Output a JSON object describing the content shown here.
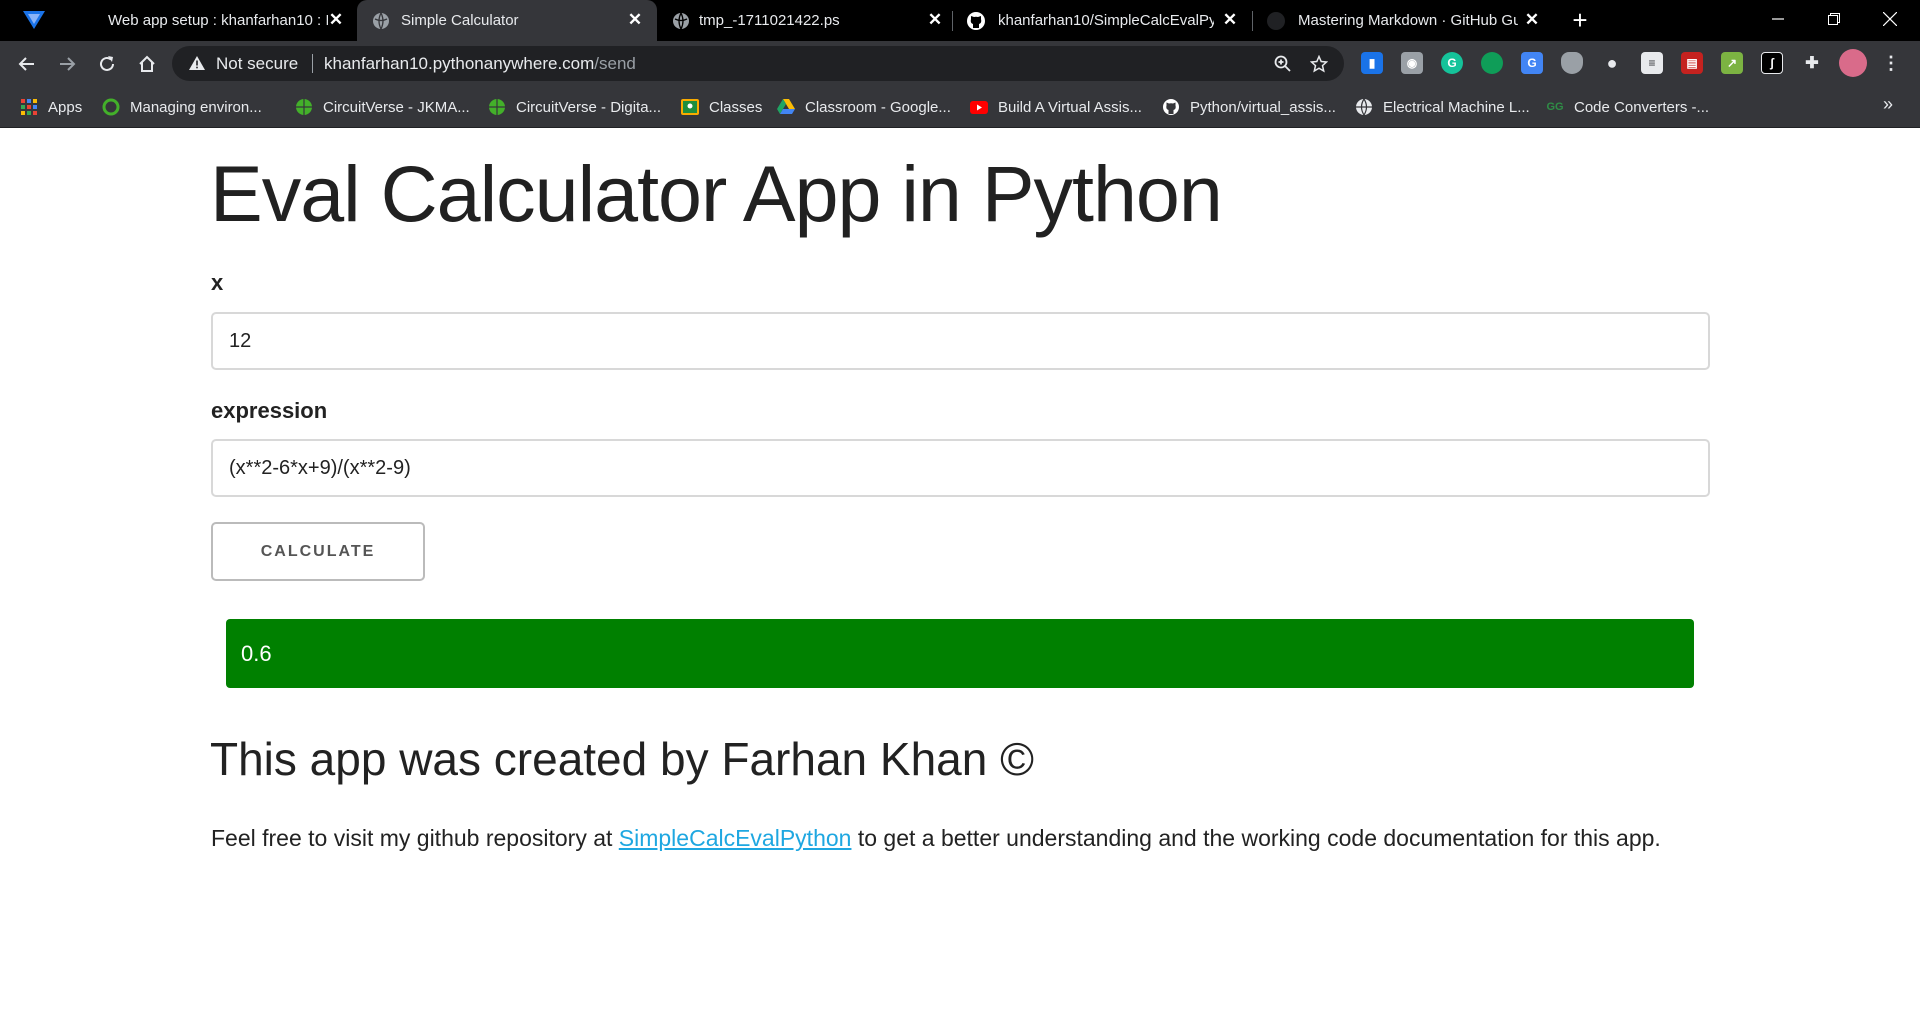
{
  "browser": {
    "tabs": [
      {
        "title": "Web app setup : khanfarhan10 : I",
        "icon": "pythonanywhere-icon",
        "active": false
      },
      {
        "title": "Simple Calculator",
        "icon": "globe-icon",
        "active": true
      },
      {
        "title": "tmp_-1711021422.ps",
        "icon": "globe-icon",
        "active": false
      },
      {
        "title": "khanfarhan10/SimpleCalcEvalPyth",
        "icon": "github-icon",
        "active": false
      },
      {
        "title": "Mastering Markdown · GitHub Gu",
        "icon": "github-icon",
        "active": false
      }
    ],
    "security_label": "Not secure",
    "url_host": "khanfarhan10.pythonanywhere.com",
    "url_path": "/send",
    "bookmarks": [
      {
        "label": "Apps",
        "icon": "apps-grid-icon",
        "color": "#4285f4"
      },
      {
        "label": "Managing environ...",
        "icon": "conda-icon",
        "color": "#43b02a"
      },
      {
        "label": "CircuitVerse - JKMA...",
        "icon": "globe-icon",
        "color": "#43b02a"
      },
      {
        "label": "CircuitVerse - Digita...",
        "icon": "globe-icon",
        "color": "#43b02a"
      },
      {
        "label": "Classes",
        "icon": "classroom-icon",
        "color": "#f9ab00"
      },
      {
        "label": "Classroom - Google...",
        "icon": "drive-icon",
        "color": "#1fa463"
      },
      {
        "label": "Build A Virtual Assis...",
        "icon": "youtube-icon",
        "color": "#ff0000"
      },
      {
        "label": "Python/virtual_assis...",
        "icon": "github-icon",
        "color": "#ffffff"
      },
      {
        "label": "Electrical Machine L...",
        "icon": "globe-icon",
        "color": "#ffffff"
      },
      {
        "label": "Code Converters -...",
        "icon": "gfg-icon",
        "color": "#2f8d46"
      }
    ]
  },
  "app": {
    "title": "Eval Calculator App in Python",
    "x_label": "x",
    "x_value": "12",
    "expression_label": "expression",
    "expression_value": "(x**2-6*x+9)/(x**2-9)",
    "calculate_label": "CALCULATE",
    "result": "0.6",
    "credit": "This app was created by Farhan Khan ©",
    "desc_before": "Feel free to visit my github repository at ",
    "desc_link": "SimpleCalcEvalPython",
    "desc_after": " to get a better understanding and the working code documentation for this app."
  },
  "colors": {
    "result_bg": "#008000",
    "link": "#1ea7e1"
  }
}
